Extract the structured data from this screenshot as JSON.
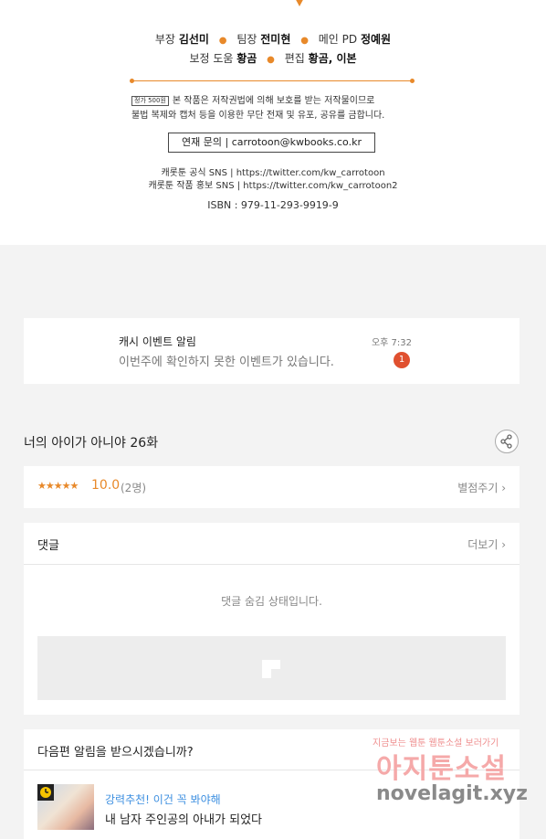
{
  "credits": {
    "line1": [
      {
        "role": "부장",
        "name": "김선미"
      },
      {
        "role": "팀장",
        "name": "전미현"
      },
      {
        "role": "메인 PD",
        "name": "정예원"
      }
    ],
    "line2": [
      {
        "role": "보정 도움",
        "name": "황곰"
      },
      {
        "role": "편집",
        "name": "황곰, 이본"
      }
    ],
    "price_badge": "정가 500원",
    "copyright_line1": "본 작품은 저작권법에 의해 보호를 받는 저작물이므로",
    "copyright_line2": "불법 복제와 캡처 등을 이용한 무단 전재 및 유포, 공유를 금합니다.",
    "contact": "연재 문의 | carrotoon@kwbooks.co.kr",
    "sns1": "캐롯툰 공식 SNS | https://twitter.com/kw_carrotoon",
    "sns2": "캐롯툰 작품 홍보 SNS | https://twitter.com/kw_carrotoon2",
    "isbn": "ISBN : 979-11-293-9919-9",
    "accent_color": "#e8892a"
  },
  "notification": {
    "title": "캐시 이벤트 알림",
    "message": "이번주에 확인하지 못한 이벤트가 있습니다.",
    "time": "오후 7:32",
    "badge_count": "1"
  },
  "episode": {
    "title": "너의 아이가 아니야 26화",
    "share_icon": "share-icon"
  },
  "rating": {
    "stars": "★★★★★",
    "score": "10.0",
    "count": "(2명)",
    "rate_label": "별점주기 ›"
  },
  "comments": {
    "heading": "댓글",
    "more_label": "더보기 ›",
    "hidden_text": "댓글 숨김 상태입니다."
  },
  "next_alert": {
    "question": "다음편 알림을 받으시겠습니까?",
    "rec_tag": "강력추천! 이건 꼭 봐야해",
    "rec_title": "내 남자 주인공의 아내가 되었다",
    "rec_icon": "clock-icon"
  },
  "watermark": {
    "top": "지금보는 웹툰 웹툰소설 보러가기",
    "middle": "아지툰소설",
    "bottom": "novelagit.xyz"
  }
}
